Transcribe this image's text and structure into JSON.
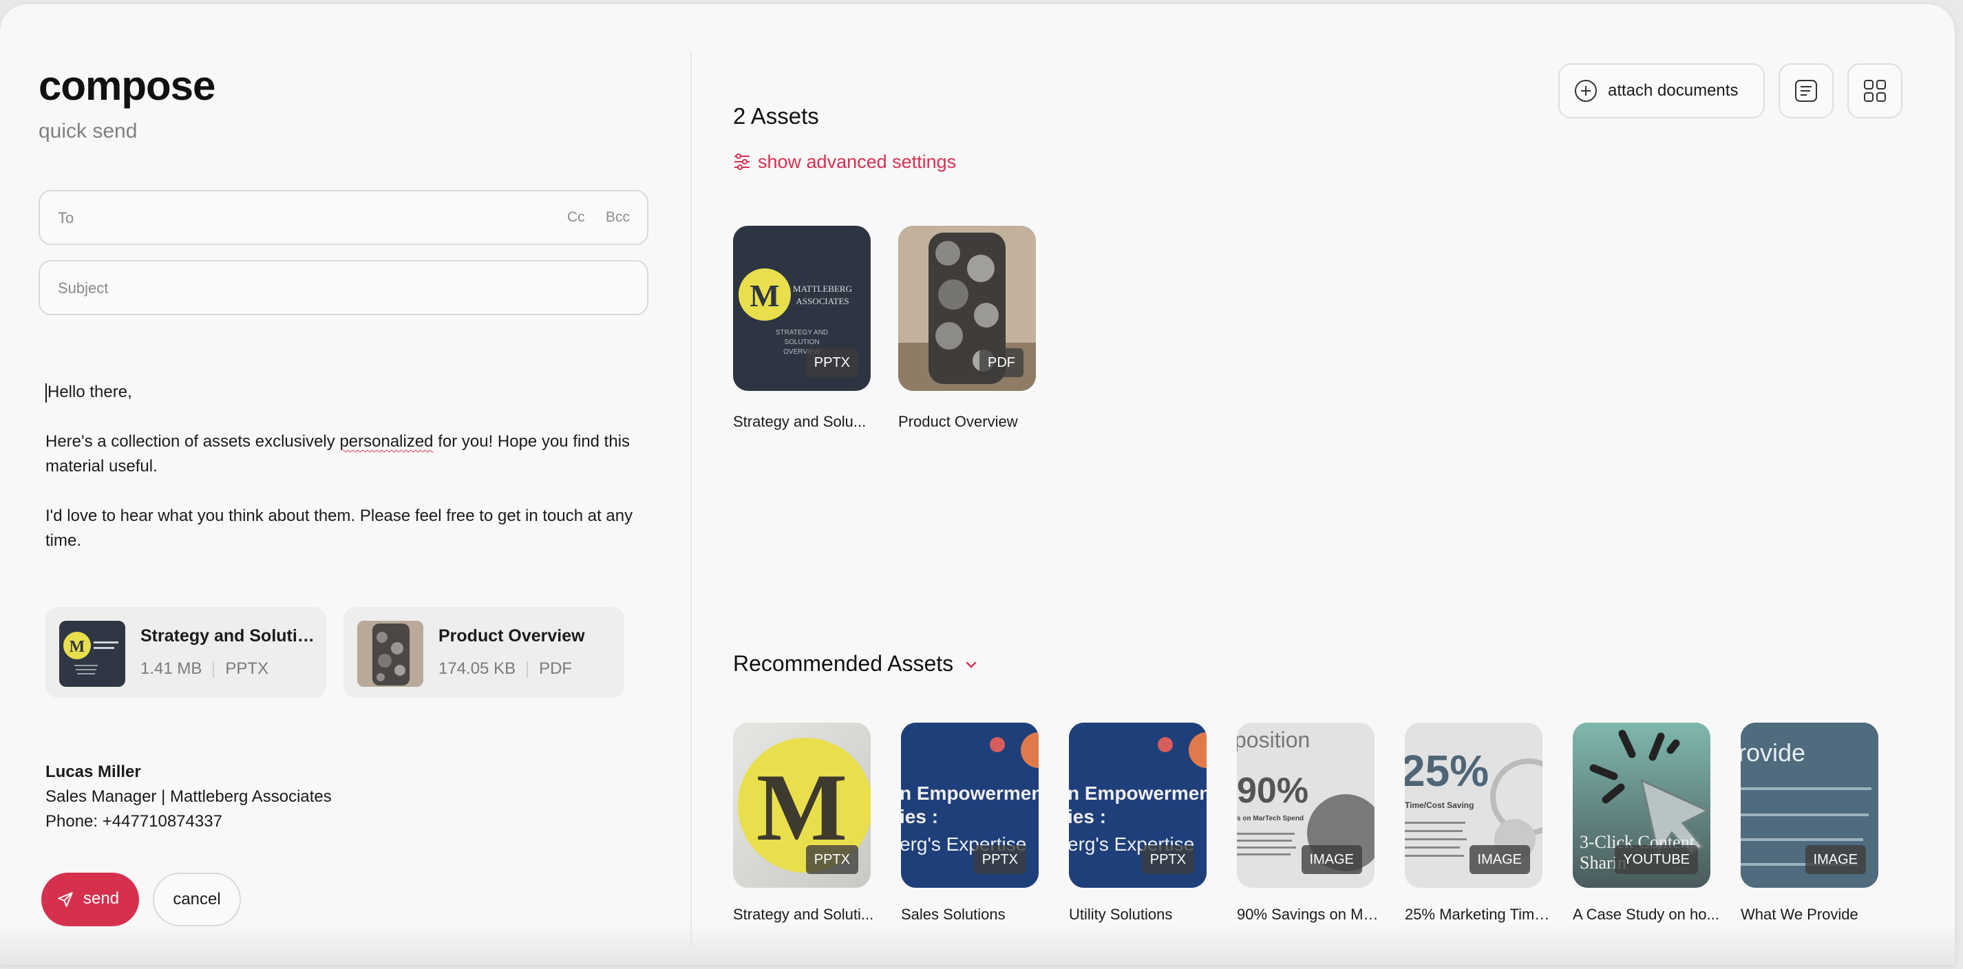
{
  "compose": {
    "title": "compose",
    "subtitle": "quick send",
    "to_placeholder": "To",
    "cc_label": "Cc",
    "bcc_label": "Bcc",
    "subject_placeholder": "Subject",
    "body": {
      "greeting": "Hello there,",
      "p1_before": "Here's a collection of assets exclusively ",
      "p1_misspelled": "personalized",
      "p1_after": " for you! Hope you find this material useful.",
      "p2": "I'd love to hear what you think about them. Please feel free to get in touch at any time."
    },
    "attachments": [
      {
        "name": "Strategy and Solutio...",
        "size": "1.41 MB",
        "type": "PPTX"
      },
      {
        "name": "Product Overview",
        "size": "174.05 KB",
        "type": "PDF"
      }
    ],
    "signature": {
      "name": "Lucas Miller",
      "title": "Sales Manager | Mattleberg Associates",
      "phone": "Phone: +447710874337"
    },
    "send_label": "send",
    "cancel_label": "cancel"
  },
  "assets_panel": {
    "attach_label": "attach documents",
    "count_label": "2 Assets",
    "advanced_label": "show advanced settings",
    "assets": [
      {
        "label": "Strategy and Solu...",
        "badge": "PPTX",
        "thumb_text": {
          "line1": "MATTLEBERG",
          "line2": "ASSOCIATES",
          "line3": "STRATEGY AND",
          "line4": "SOLUTION",
          "line5": "OVERVIEW"
        }
      },
      {
        "label": "Product Overview",
        "badge": "PDF"
      }
    ],
    "recommended_title": "Recommended Assets",
    "recommended": [
      {
        "label": "Strategy and Soluti...",
        "badge": "PPTX"
      },
      {
        "label": "Sales Solutions",
        "badge": "PPTX",
        "thumb_text": {
          "line1": "n Empowermen",
          "line2": "ies :",
          "line3": "erg's Expertise"
        }
      },
      {
        "label": "Utility Solutions",
        "badge": "PPTX",
        "thumb_text": {
          "line1": "n Empowermen",
          "line2": "ies :",
          "line3": "erg's Expertise"
        }
      },
      {
        "label": "90% Savings on Mar...",
        "badge": "IMAGE",
        "thumb_text": {
          "line1": "position",
          "line2": "90%",
          "line3": "s on MarTech Spend"
        }
      },
      {
        "label": "25% Marketing Time...",
        "badge": "IMAGE",
        "thumb_text": {
          "line1": "25%",
          "line2": "Time/Cost Saving"
        }
      },
      {
        "label": "A Case Study on ho...",
        "badge": "YOUTUBE",
        "thumb_text": {
          "line1": "3-Click Content",
          "line2": "Sharin"
        }
      },
      {
        "label": "What We Provide",
        "badge": "IMAGE",
        "thumb_text": {
          "line1": "rovide"
        }
      }
    ]
  },
  "colors": {
    "accent": "#d6304f",
    "text": "#1b1b1b",
    "muted": "#808080",
    "background": "#f8f8f8"
  }
}
